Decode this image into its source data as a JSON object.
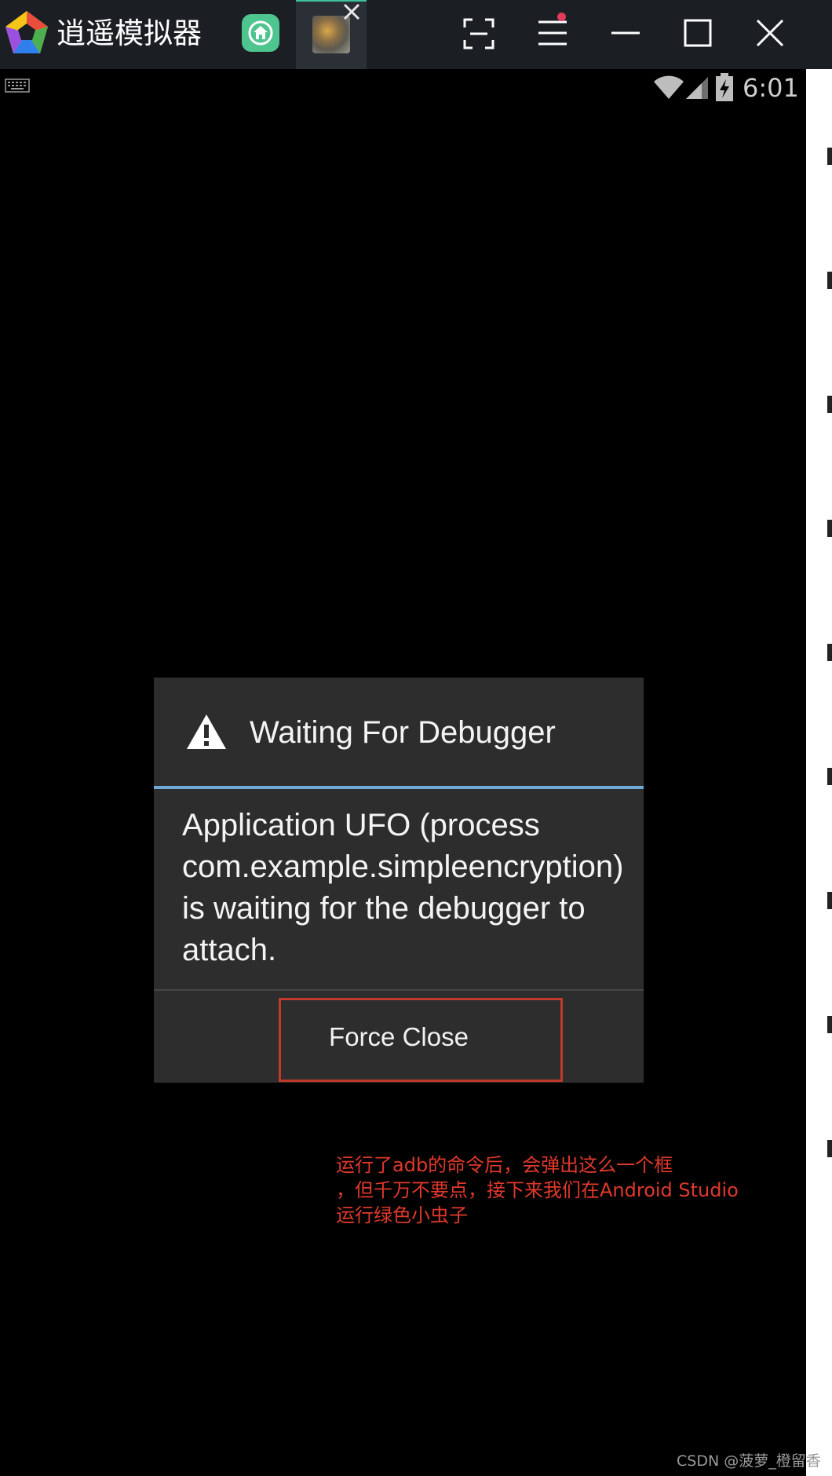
{
  "emulator": {
    "title": "逍遥模拟器",
    "tabs": [
      {
        "name": "home",
        "icon": "home-icon"
      },
      {
        "name": "app",
        "icon": "app-thumbnail"
      }
    ],
    "controls": [
      "fullscreen-icon",
      "menu-icon",
      "minimize-icon",
      "maximize-icon",
      "close-icon"
    ]
  },
  "statusbar": {
    "time": "6:01",
    "icons": [
      "keyboard-icon",
      "wifi-icon",
      "signal-icon",
      "battery-charging-icon"
    ]
  },
  "dialog": {
    "title": "Waiting For Debugger",
    "message": "Application UFO (process com.example.simpleencryption) is waiting for the debugger to attach.",
    "button": "Force Close",
    "icon": "warning-icon"
  },
  "annotation": {
    "lines": [
      "运行了adb的命令后，会弹出这么一个框",
      "，但千万不要点，接下来我们在Android Studio",
      "运行绿色小虫子"
    ],
    "color": "#e0392b"
  },
  "watermark": "CSDN @菠萝_橙留香",
  "colors": {
    "titlebar": "#1b1f24",
    "dialog_bg": "#2d2d2d",
    "divider_accent": "#6fa9d6",
    "highlight": "#c0392b"
  }
}
